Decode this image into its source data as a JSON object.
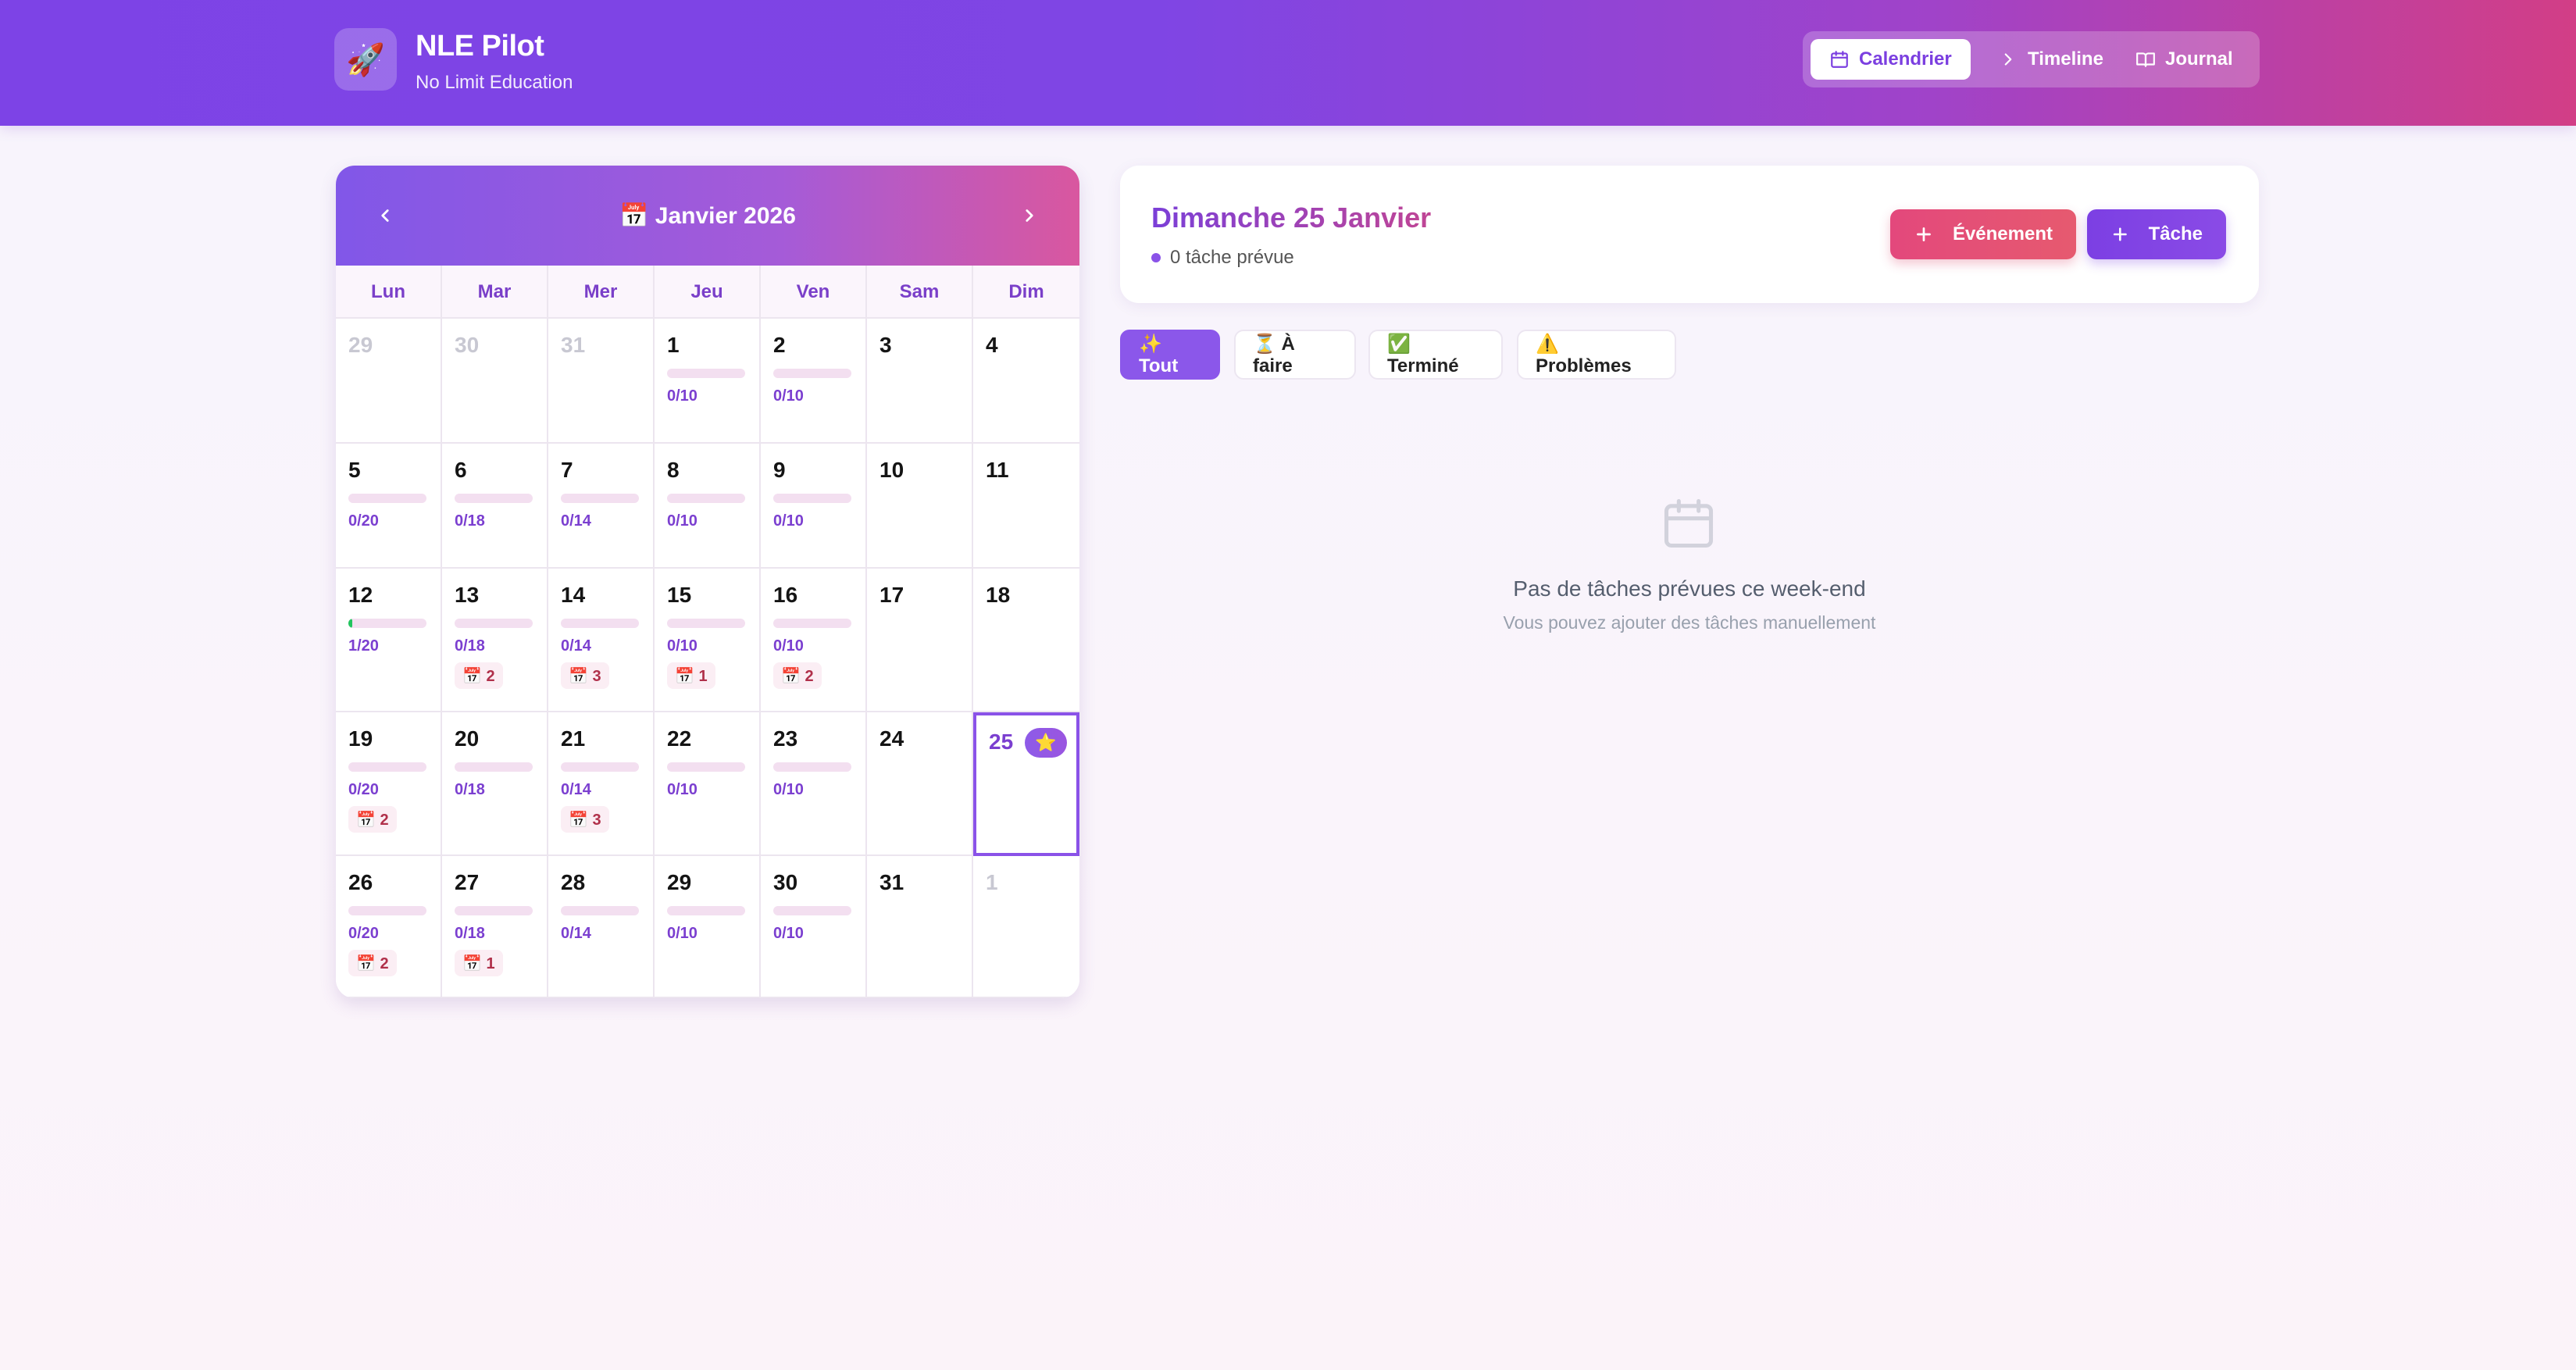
{
  "app": {
    "logo_glyph": "🚀",
    "title": "NLE Pilot",
    "subtitle": "No Limit Education"
  },
  "nav": {
    "tabs": [
      {
        "label": "Calendrier",
        "icon": "calendar-icon",
        "active": true
      },
      {
        "label": "Timeline",
        "icon": "chevron-right-icon",
        "active": false
      },
      {
        "label": "Journal",
        "icon": "book-icon",
        "active": false
      }
    ]
  },
  "calendar": {
    "title": "📅 Janvier 2026",
    "weekdays": [
      "Lun",
      "Mar",
      "Mer",
      "Jeu",
      "Ven",
      "Sam",
      "Dim"
    ],
    "rows": [
      [
        {
          "day": "29",
          "other": true
        },
        {
          "day": "30",
          "other": true
        },
        {
          "day": "31",
          "other": true
        },
        {
          "day": "1",
          "tasks": "0/10",
          "progress": 0
        },
        {
          "day": "2",
          "tasks": "0/10",
          "progress": 0
        },
        {
          "day": "3"
        },
        {
          "day": "4"
        }
      ],
      [
        {
          "day": "5",
          "tasks": "0/20",
          "progress": 0
        },
        {
          "day": "6",
          "tasks": "0/18",
          "progress": 0
        },
        {
          "day": "7",
          "tasks": "0/14",
          "progress": 0
        },
        {
          "day": "8",
          "tasks": "0/10",
          "progress": 0
        },
        {
          "day": "9",
          "tasks": "0/10",
          "progress": 0
        },
        {
          "day": "10"
        },
        {
          "day": "11"
        }
      ],
      [
        {
          "day": "12",
          "tasks": "1/20",
          "progress": 0.05
        },
        {
          "day": "13",
          "tasks": "0/18",
          "progress": 0,
          "events": "📅 2"
        },
        {
          "day": "14",
          "tasks": "0/14",
          "progress": 0,
          "events": "📅 3"
        },
        {
          "day": "15",
          "tasks": "0/10",
          "progress": 0,
          "events": "📅 1"
        },
        {
          "day": "16",
          "tasks": "0/10",
          "progress": 0,
          "events": "📅 2"
        },
        {
          "day": "17"
        },
        {
          "day": "18"
        }
      ],
      [
        {
          "day": "19",
          "tasks": "0/20",
          "progress": 0,
          "events": "📅 2"
        },
        {
          "day": "20",
          "tasks": "0/18",
          "progress": 0
        },
        {
          "day": "21",
          "tasks": "0/14",
          "progress": 0,
          "events": "📅 3"
        },
        {
          "day": "22",
          "tasks": "0/10",
          "progress": 0
        },
        {
          "day": "23",
          "tasks": "0/10",
          "progress": 0
        },
        {
          "day": "24"
        },
        {
          "day": "25",
          "today": true,
          "badge": "⭐"
        }
      ],
      [
        {
          "day": "26",
          "tasks": "0/20",
          "progress": 0,
          "events": "📅 2"
        },
        {
          "day": "27",
          "tasks": "0/18",
          "progress": 0,
          "events": "📅 1"
        },
        {
          "day": "28",
          "tasks": "0/14",
          "progress": 0
        },
        {
          "day": "29",
          "tasks": "0/10",
          "progress": 0
        },
        {
          "day": "30",
          "tasks": "0/10",
          "progress": 0
        },
        {
          "day": "31"
        },
        {
          "day": "1",
          "other": true
        }
      ]
    ]
  },
  "day": {
    "title": "Dimanche 25 Janvier",
    "subtitle": "0 tâche prévue",
    "event_button": "Événement",
    "task_button": "Tâche"
  },
  "filters": [
    {
      "label": "✨ Tout",
      "active": true
    },
    {
      "label": "⏳ À faire",
      "active": false
    },
    {
      "label": "✅ Terminé",
      "active": false
    },
    {
      "label": "⚠️ Problèmes",
      "active": false
    }
  ],
  "empty": {
    "icon": "calendar-icon",
    "title": "Pas de tâches prévues ce week-end",
    "subtitle": "Vous pouvez ajouter des tâches manuellement"
  },
  "colors": {
    "primary": "#7b3fe0",
    "accent": "#e3487c",
    "progress": "#22c55e"
  }
}
